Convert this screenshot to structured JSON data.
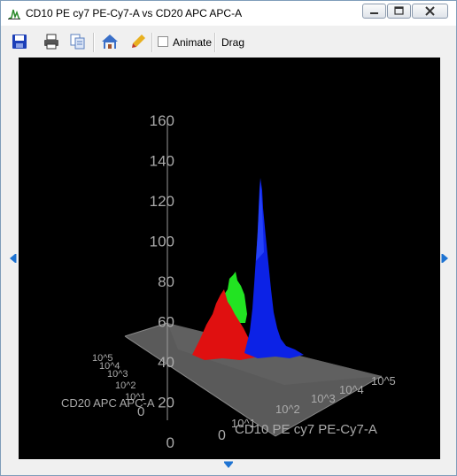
{
  "window": {
    "title": "CD10 PE cy7 PE-Cy7-A vs CD20 APC APC-A"
  },
  "toolbar": {
    "save_icon": "save-icon",
    "print_icon": "print-icon",
    "copy_icon": "copy-icon",
    "home_icon": "home-icon",
    "pen_icon": "pen-icon",
    "animate_label": "Animate",
    "animate_checked": false,
    "drag_label": "Drag"
  },
  "chart_data": {
    "type": "surface3d",
    "z_ticks": [
      "160",
      "140",
      "120",
      "100",
      "80",
      "60",
      "40",
      "20",
      "0"
    ],
    "x_axis": {
      "label": "CD10 PE cy7 PE-Cy7-A",
      "ticks": [
        "0",
        "10^1",
        "10^2",
        "10^3",
        "10^4",
        "10^5"
      ]
    },
    "y_axis": {
      "label": "CD20 APC APC-A",
      "ticks": [
        "10^5",
        "10^4",
        "10^3",
        "10^2",
        "10^1",
        "0"
      ]
    },
    "peaks": [
      {
        "color": "#0000ff",
        "height": 132
      },
      {
        "color": "#00ff00",
        "height": 80
      },
      {
        "color": "#ff0000",
        "height": 64
      }
    ],
    "background": "#000000"
  }
}
